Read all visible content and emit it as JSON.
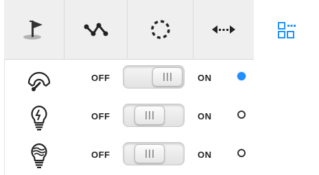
{
  "tabs": [
    {
      "name": "tab-flag",
      "icon": "golf-flag-icon",
      "active": false
    },
    {
      "name": "tab-path",
      "icon": "zigzag-path-icon",
      "active": false
    },
    {
      "name": "tab-circle",
      "icon": "dashed-circle-icon",
      "active": false
    },
    {
      "name": "tab-distance",
      "icon": "horizontal-arrows-icon",
      "active": false
    },
    {
      "name": "tab-grid",
      "icon": "grid-menu-icon",
      "active": true
    }
  ],
  "rows": [
    {
      "icon": "speedometer-icon",
      "off_label": "OFF",
      "on_label": "ON",
      "toggle_state": "off",
      "radio_selected": true
    },
    {
      "icon": "lightbulb-icon",
      "off_label": "OFF",
      "on_label": "ON",
      "toggle_state": "off",
      "radio_selected": false
    },
    {
      "icon": "heat-lamp-icon",
      "off_label": "OFF",
      "on_label": "ON",
      "toggle_state": "off",
      "radio_selected": false
    }
  ],
  "colors": {
    "accent": "#1e90ff",
    "tab_bg": "#efefef",
    "active_tab_bg": "#ffffff"
  }
}
